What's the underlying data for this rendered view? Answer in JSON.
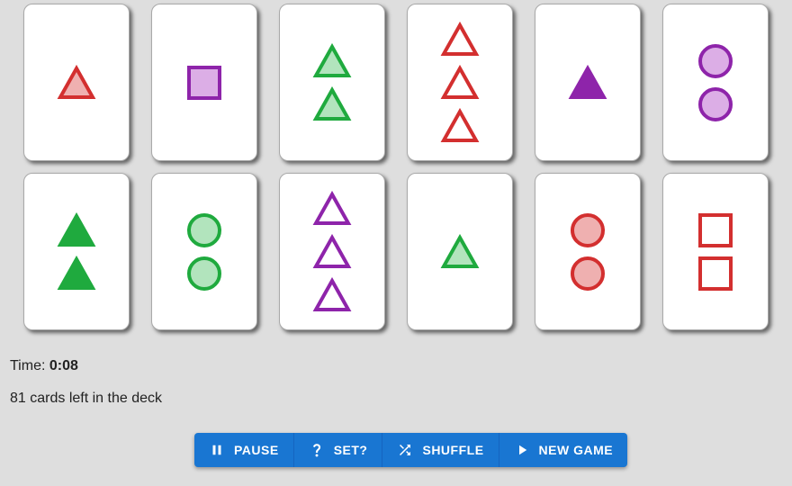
{
  "colors": {
    "red": "#d32f2f",
    "green": "#1faa3e",
    "purple": "#8e24aa"
  },
  "shading_fill": {
    "red": {
      "solid": "#d32f2f",
      "striped": "#efb0b0",
      "open": "#ffffff"
    },
    "green": {
      "solid": "#1faa3e",
      "striped": "#b2e4bd",
      "open": "#ffffff"
    },
    "purple": {
      "solid": "#8e24aa",
      "striped": "#dcaee6",
      "open": "#ffffff"
    }
  },
  "board": [
    {
      "count": 1,
      "shape": "triangle",
      "color": "red",
      "shading": "striped"
    },
    {
      "count": 1,
      "shape": "square",
      "color": "purple",
      "shading": "striped"
    },
    {
      "count": 2,
      "shape": "triangle",
      "color": "green",
      "shading": "striped"
    },
    {
      "count": 3,
      "shape": "triangle",
      "color": "red",
      "shading": "open"
    },
    {
      "count": 1,
      "shape": "triangle",
      "color": "purple",
      "shading": "solid"
    },
    {
      "count": 2,
      "shape": "circle",
      "color": "purple",
      "shading": "striped"
    },
    {
      "count": 2,
      "shape": "triangle",
      "color": "green",
      "shading": "solid"
    },
    {
      "count": 2,
      "shape": "circle",
      "color": "green",
      "shading": "striped"
    },
    {
      "count": 3,
      "shape": "triangle",
      "color": "purple",
      "shading": "open"
    },
    {
      "count": 1,
      "shape": "triangle",
      "color": "green",
      "shading": "striped"
    },
    {
      "count": 2,
      "shape": "circle",
      "color": "red",
      "shading": "striped"
    },
    {
      "count": 2,
      "shape": "square",
      "color": "red",
      "shading": "open"
    }
  ],
  "status": {
    "time_label": "Time: ",
    "time_value": "0:08",
    "deck_text": "81 cards left in the deck"
  },
  "toolbar": {
    "pause_label": "PAUSE",
    "set_label": "SET?",
    "shuffle_label": "SHUFFLE",
    "new_game_label": "NEW GAME"
  },
  "icons": {
    "pause": "pause-icon",
    "set": "question-mark-icon",
    "shuffle": "shuffle-icon",
    "new_game": "play-icon"
  }
}
